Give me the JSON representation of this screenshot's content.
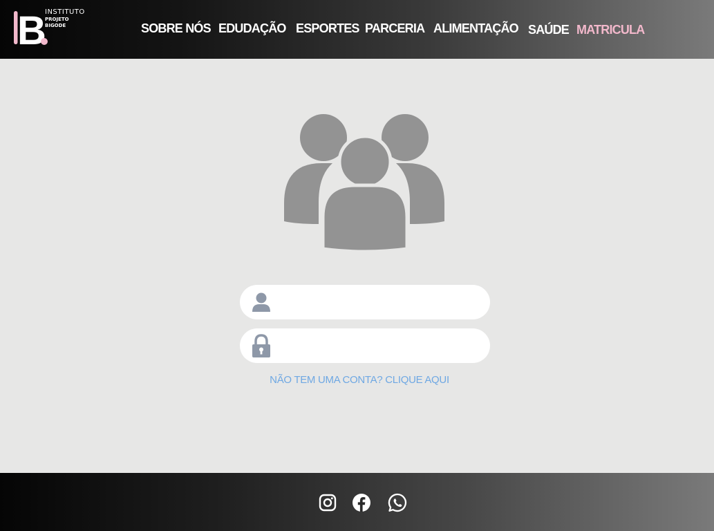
{
  "header": {
    "logo": {
      "line1": "INSTITUTO",
      "line2": "PROJETO",
      "line3": "BIGODE",
      "mark_text": "IB",
      "mark_dot_color": "#f2b8cb"
    },
    "nav": [
      {
        "label": "SOBRE NÓS",
        "active": false
      },
      {
        "label": "EDUDAÇÃO",
        "active": false
      },
      {
        "label": "ESPORTES",
        "active": false
      },
      {
        "label": "PARCERIA",
        "active": false
      },
      {
        "label": "ALIMENTAÇÃO",
        "active": false
      },
      {
        "label": "SAÚDE",
        "active": false
      },
      {
        "label": "MATRICULA",
        "active": true
      }
    ]
  },
  "login": {
    "hero_icon": "users-group-icon",
    "username": {
      "icon": "user-icon",
      "value": "",
      "placeholder": ""
    },
    "password": {
      "icon": "lock-icon",
      "value": "",
      "placeholder": ""
    },
    "signup_link": "NÃO TEM UMA CONTA? CLIQUE AQUI"
  },
  "footer": {
    "social": [
      {
        "icon": "instagram-icon"
      },
      {
        "icon": "facebook-icon"
      },
      {
        "icon": "whatsapp-icon"
      }
    ]
  },
  "colors": {
    "page_bg": "#e7e7e6",
    "accent_pink": "#f2b8cb",
    "link_blue": "#6fa8e3",
    "icon_gray": "#939393",
    "field_icon": "#8e98a8"
  }
}
